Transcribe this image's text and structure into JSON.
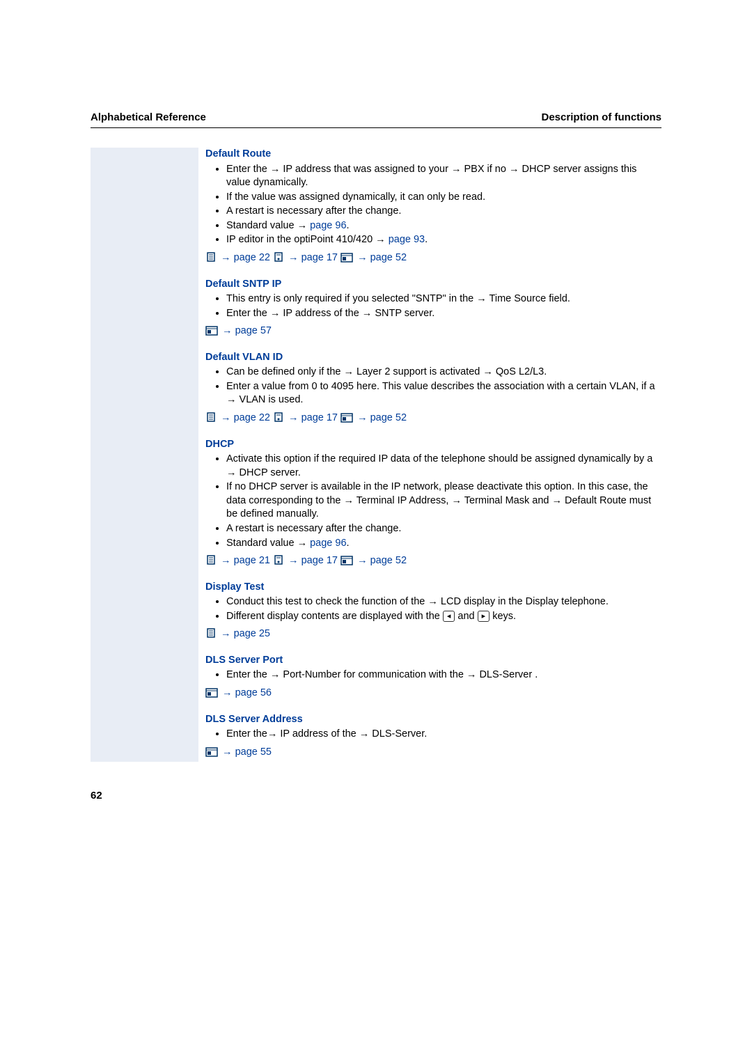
{
  "header": {
    "left": "Alphabetical Reference",
    "right": "Description of functions"
  },
  "page_number": "62",
  "sections": [
    {
      "heading": "Default Route",
      "bullets": [
        "Enter the → IP address that was assigned to your → PBX if no → DHCP server assigns this value dynamically.",
        "If the value was assigned dynamically, it can only be read.",
        "A restart is necessary after the change.",
        "Standard value → page 96.",
        "IP editor in the optiPoint 410/420 → page 93."
      ],
      "refs": [
        "page 22",
        "page 17",
        "page 52"
      ]
    },
    {
      "heading": "Default SNTP IP",
      "bullets": [
        "This entry is only required if you selected \"SNTP\" in the → Time Source field.",
        "Enter the → IP address of the → SNTP server."
      ],
      "refs": [
        "page 57"
      ]
    },
    {
      "heading": "Default VLAN ID",
      "bullets": [
        "Can be defined only if the → Layer 2 support is activated → QoS L2/L3.",
        "Enter a value from 0 to 4095 here. This value describes the association with a certain VLAN, if a → VLAN is used."
      ],
      "refs": [
        "page 22",
        "page 17",
        "page 52"
      ]
    },
    {
      "heading": "DHCP",
      "bullets": [
        "Activate this option if the required IP data of the telephone should be assigned dynamically by a → DHCP server.",
        "If no DHCP server is available in the IP network, please deactivate this option. In this case, the data corresponding to the → Terminal IP Address, → Terminal Mask and → Default Route must be defined manually.",
        "A restart is necessary after the change.",
        "Standard value → page 96."
      ],
      "refs": [
        "page 21",
        "page 17",
        "page 52"
      ]
    },
    {
      "heading": "Display Test",
      "bullets": [
        "Conduct this test to check the function of the → LCD display in the Display telephone.",
        "Different display contents are displayed with the ◂ and ▸ keys."
      ],
      "refs": [
        "page 25"
      ]
    },
    {
      "heading": "DLS Server Port",
      "bullets": [
        "Enter the → Port-Number for communication with the → DLS-Server ."
      ],
      "refs": [
        "page 56"
      ]
    },
    {
      "heading": "DLS Server Address",
      "bullets": [
        "Enter the→ IP address of the → DLS-Server."
      ],
      "refs": [
        "page 55"
      ]
    }
  ],
  "icons": {
    "phone": "phone-config-icon",
    "phone_alt": "phone-alt-icon",
    "web": "web-config-icon"
  }
}
